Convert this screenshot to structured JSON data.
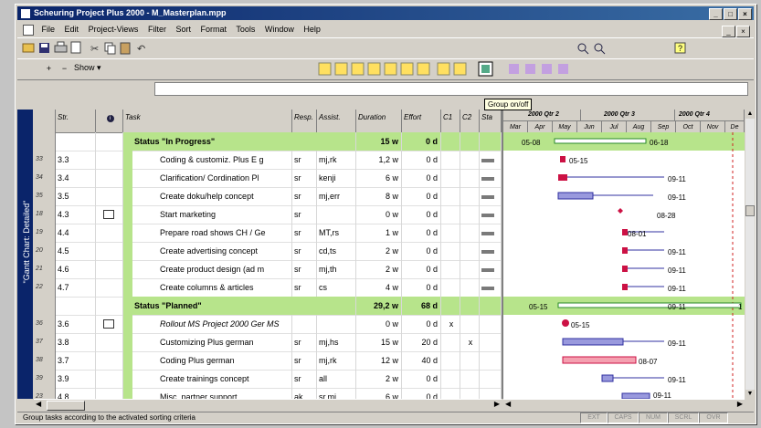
{
  "window": {
    "title": "Scheuring Project Plus 2000 - M_Masterplan.mpp",
    "buttons": [
      "_",
      "□",
      "×"
    ],
    "doc_buttons": [
      "_",
      "×"
    ]
  },
  "menu": [
    "File",
    "Edit",
    "Project-Views",
    "Filter",
    "Sort",
    "Format",
    "Tools",
    "Window",
    "Help"
  ],
  "toolbar2": {
    "show_label": "Show"
  },
  "tooltip": "Group on/off",
  "view_bar_label": "\"Gantt Chart: Detailed\"",
  "table": {
    "headers": [
      "Str.",
      "",
      "Task",
      "Resp.",
      "Assist.",
      "Duration",
      "Effort",
      "C1",
      "C2",
      "Sta"
    ],
    "rows": [
      {
        "type": "group",
        "task": "Status \"In Progress\"",
        "duration": "15 w",
        "effort": "0 d"
      },
      {
        "id": "33",
        "str": "3.3",
        "task": "Coding & customiz. Plus E g",
        "resp": "sr",
        "assist": "mj,rk",
        "duration": "1,2 w",
        "effort": "0 d",
        "status": true
      },
      {
        "id": "34",
        "str": "3.4",
        "task": "Clarification/ Cordination Pl",
        "resp": "sr",
        "assist": "kenji",
        "duration": "6 w",
        "effort": "0 d",
        "status": true
      },
      {
        "id": "35",
        "str": "3.5",
        "task": "Create doku/help concept",
        "resp": "sr",
        "assist": "mj,err",
        "duration": "8 w",
        "effort": "0 d",
        "status": true
      },
      {
        "id": "18",
        "str": "4.3",
        "note": true,
        "task": "Start marketing",
        "resp": "sr",
        "assist": "",
        "duration": "0 w",
        "effort": "0 d",
        "status": true
      },
      {
        "id": "19",
        "str": "4.4",
        "task": "Prepare road shows CH / Ge",
        "resp": "sr",
        "assist": "MT,rs",
        "duration": "1 w",
        "effort": "0 d",
        "status": true
      },
      {
        "id": "20",
        "str": "4.5",
        "task": "Create advertising concept",
        "resp": "sr",
        "assist": "cd,ts",
        "duration": "2 w",
        "effort": "0 d",
        "status": true
      },
      {
        "id": "21",
        "str": "4.6",
        "task": "Create product design (ad m",
        "resp": "sr",
        "assist": "mj,th",
        "duration": "2 w",
        "effort": "0 d",
        "status": true
      },
      {
        "id": "22",
        "str": "4.7",
        "task": "Create columns & articles",
        "resp": "sr",
        "assist": "cs",
        "duration": "4 w",
        "effort": "0 d",
        "status": true
      },
      {
        "type": "group",
        "task": "Status \"Planned\"",
        "duration": "29,2 w",
        "effort": "68 d"
      },
      {
        "id": "36",
        "str": "3.6",
        "note": true,
        "task": "Rollout MS Project 2000 Ger MS",
        "italic": true,
        "resp": "",
        "assist": "",
        "duration": "0 w",
        "effort": "0 d",
        "c1": "x",
        "status": false
      },
      {
        "id": "37",
        "str": "3.8",
        "task": "Customizing Plus german",
        "resp": "sr",
        "assist": "mj,hs",
        "duration": "15 w",
        "effort": "20 d",
        "c2": "x",
        "status": false
      },
      {
        "id": "38",
        "str": "3.7",
        "task": "Coding Plus german",
        "resp": "sr",
        "assist": "mj,rk",
        "duration": "12 w",
        "effort": "40 d",
        "status": false
      },
      {
        "id": "39",
        "str": "3.9",
        "task": "Create trainings concept",
        "resp": "sr",
        "assist": "all",
        "duration": "2 w",
        "effort": "0 d",
        "status": false
      },
      {
        "id": "23",
        "str": "4.8",
        "task": "Misc. partner support",
        "resp": "ak",
        "assist": "sr,mj",
        "duration": "6 w",
        "effort": "0 d",
        "status": false
      }
    ]
  },
  "gantt": {
    "quarters": [
      "2000 Qtr 2",
      "2000 Qtr 3",
      "2000 Qtr 4"
    ],
    "months": [
      "Mar",
      "Apr",
      "May",
      "Jun",
      "Jul",
      "Aug",
      "Sep",
      "Oct",
      "Nov",
      "De"
    ],
    "labels": [
      "05-08",
      "06-18",
      "05-15",
      "09-11",
      "09-11",
      "08-28",
      "08-01",
      "09-11",
      "09-11",
      "09-11",
      "09-11",
      "05-15",
      "1",
      "05-15",
      "09-11",
      "08-07",
      "09-11",
      "09-11"
    ]
  },
  "status_bar": {
    "text": "Group tasks according to the activated sorting criteria",
    "indicators": [
      "EXT",
      "CAPS",
      "NUM",
      "SCRL",
      "OVR"
    ]
  },
  "colors": {
    "group_fill": "#b7e48b",
    "title_bar": "#0a246a",
    "bar_blue": "#9999dd",
    "bar_red": "#cc1144",
    "bar_pink": "#f4a0b0"
  }
}
